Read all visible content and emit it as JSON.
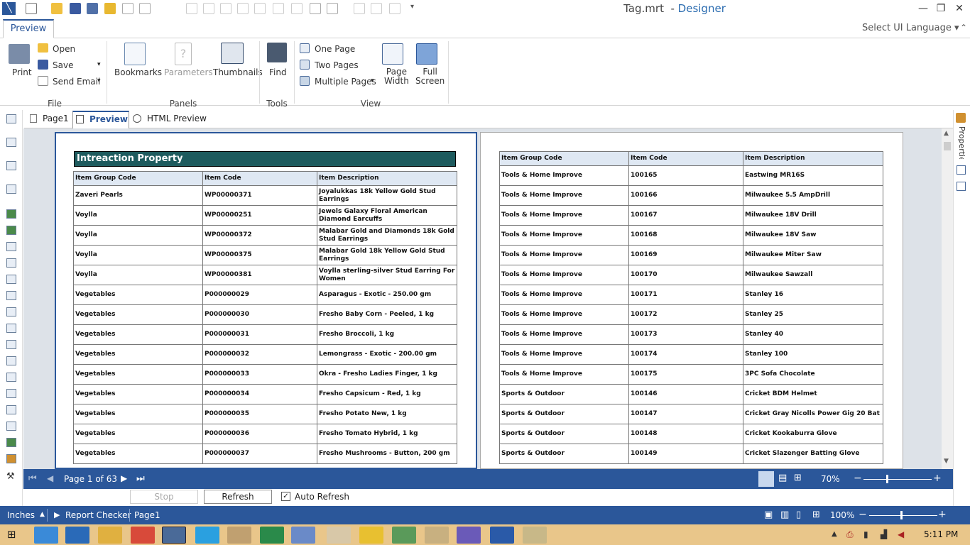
{
  "window": {
    "title": "Tag.mrt",
    "app": "Designer",
    "min": "—",
    "max": "❐",
    "close": "✕"
  },
  "ribbon_tab": "Preview",
  "select_ui": "Select UI Language",
  "file": {
    "print": "Print",
    "open": "Open",
    "save": "Save",
    "send_email": "Send Email",
    "group": "File"
  },
  "panels": {
    "bookmarks": "Bookmarks",
    "parameters": "Parameters",
    "thumbnails": "Thumbnails",
    "group": "Panels"
  },
  "tools": {
    "find": "Find",
    "group": "Tools"
  },
  "view": {
    "one_page": "One Page",
    "two_pages": "Two Pages",
    "multiple_pages": "Multiple Pages",
    "page": "Page",
    "width": "Width",
    "full": "Full",
    "screen": "Screen",
    "group": "View"
  },
  "doc_tabs": [
    "Page1",
    "Preview",
    "HTML Preview"
  ],
  "report": {
    "title": "Intreaction Property",
    "columns": [
      "Item Group Code",
      "Item Code",
      "Item Description"
    ],
    "page1": [
      [
        "Zaveri Pearls",
        "WP00000371",
        "Joyalukkas 18k Yellow Gold Stud Earrings"
      ],
      [
        "Voylla",
        "WP00000251",
        "Jewels Galaxy Floral American Diamond Earcuffs"
      ],
      [
        "Voylla",
        "WP00000372",
        "Malabar Gold and Diamonds 18k Gold Stud Earrings"
      ],
      [
        "Voylla",
        "WP00000375",
        "Malabar Gold 18k Yellow Gold Stud Earrings"
      ],
      [
        "Voylla",
        "WP00000381",
        "Voylla sterling-silver Stud Earring For Women"
      ],
      [
        "Vegetables",
        "P000000029",
        "Asparagus - Exotic - 250.00 gm"
      ],
      [
        "Vegetables",
        "P000000030",
        "Fresho Baby Corn - Peeled, 1 kg"
      ],
      [
        "Vegetables",
        "P000000031",
        "Fresho Broccoli, 1 kg"
      ],
      [
        "Vegetables",
        "P000000032",
        "Lemongrass - Exotic - 200.00 gm"
      ],
      [
        "Vegetables",
        "P000000033",
        "Okra - Fresho Ladies Finger, 1 kg"
      ],
      [
        "Vegetables",
        "P000000034",
        "Fresho Capsicum - Red, 1 kg"
      ],
      [
        "Vegetables",
        "P000000035",
        "Fresho Potato New, 1 kg"
      ],
      [
        "Vegetables",
        "P000000036",
        "Fresho Tomato Hybrid, 1 kg"
      ],
      [
        "Vegetables",
        "P000000037",
        "Fresho Mushrooms - Button, 200 gm"
      ]
    ],
    "page2": [
      [
        "Tools & Home Improve",
        "100165",
        "Eastwing MR16S"
      ],
      [
        "Tools & Home Improve",
        "100166",
        "Milwaukee 5.5 AmpDrill"
      ],
      [
        "Tools & Home Improve",
        "100167",
        "Milwaukee 18V Drill"
      ],
      [
        "Tools & Home Improve",
        "100168",
        "Milwaukee 18V Saw"
      ],
      [
        "Tools & Home Improve",
        "100169",
        "Milwaukee Miter Saw"
      ],
      [
        "Tools & Home Improve",
        "100170",
        "Milwaukee Sawzall"
      ],
      [
        "Tools & Home Improve",
        "100171",
        "Stanley 16"
      ],
      [
        "Tools & Home Improve",
        "100172",
        "Stanley 25"
      ],
      [
        "Tools & Home Improve",
        "100173",
        "Stanley 40"
      ],
      [
        "Tools & Home Improve",
        "100174",
        "Stanley 100"
      ],
      [
        "Tools & Home Improve",
        "100175",
        "3PC Sofa Chocolate"
      ],
      [
        "Sports & Outdoor",
        "100146",
        "Cricket BDM Helmet"
      ],
      [
        "Sports & Outdoor",
        "100147",
        "Cricket Gray Nicolls Power Gig 20 Bat"
      ],
      [
        "Sports & Outdoor",
        "100148",
        "Cricket Kookaburra Glove"
      ],
      [
        "Sports & Outdoor",
        "100149",
        "Cricket Slazenger Batting Glove"
      ]
    ]
  },
  "nav": {
    "page_label": "Page 1 of 63",
    "zoom": "70%",
    "minus": "−",
    "plus": "+"
  },
  "refresh_bar": {
    "stop": "Stop",
    "refresh": "Refresh",
    "auto_refresh": "Auto Refresh"
  },
  "status": {
    "units": "Inches",
    "report_checker": "Report Checker",
    "page": "Page1",
    "zoom": "100%"
  },
  "right_panel": "Properties",
  "taskbar": {
    "time": "5:11 PM"
  },
  "colors": {
    "accent": "#2b579a",
    "report_header": "#1e5b5e",
    "taskbar": "#e9c68a"
  }
}
